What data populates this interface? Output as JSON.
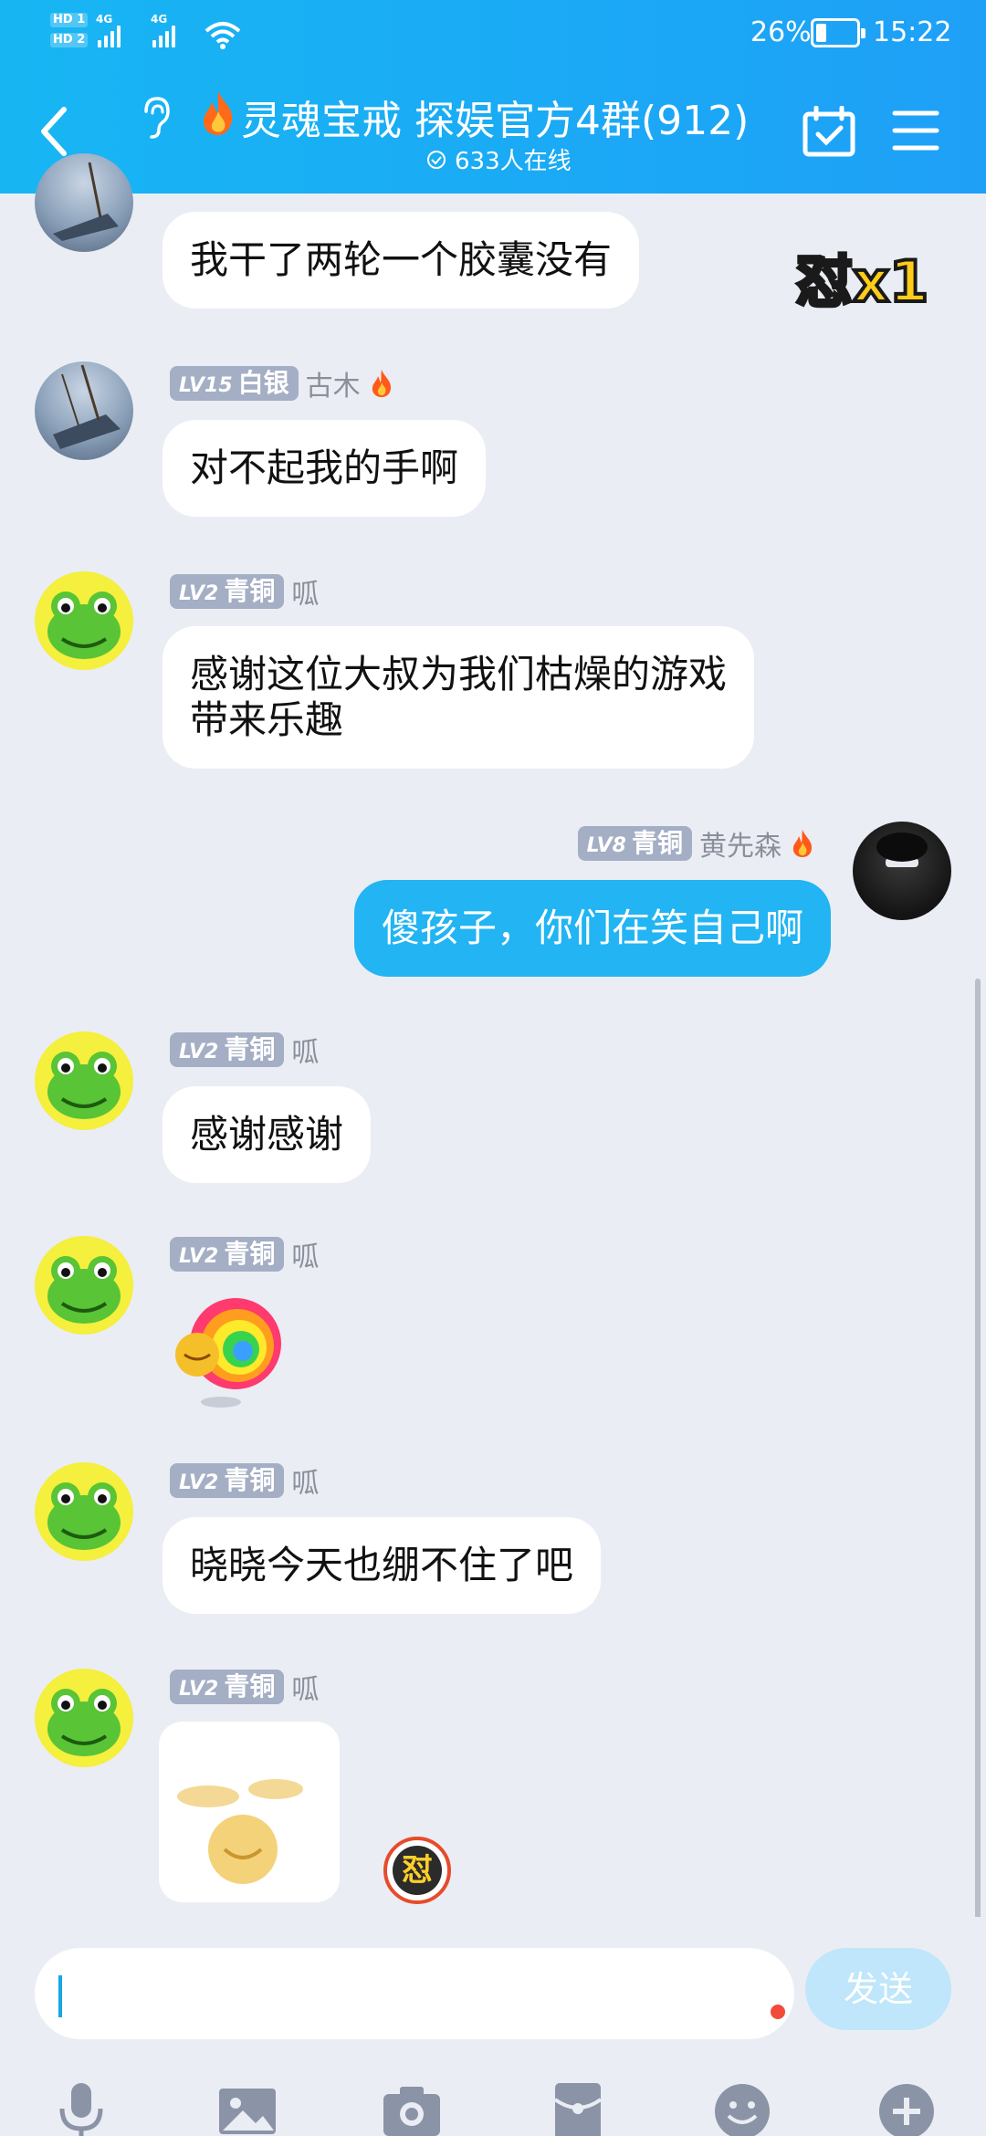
{
  "status_bar": {
    "hd1": "HD 1",
    "hd2": "HD 2",
    "net1": "4G",
    "net2": "4G",
    "battery": "26%",
    "battery_level": 0.26,
    "time": "15:22"
  },
  "header": {
    "title": "灵魂宝戒 探娱官方4群(912)",
    "online": "633人在线"
  },
  "sticker_badge": "怼",
  "sticker_banner": "怼x1",
  "messages": [
    {
      "text": "我干了两轮一个胶囊没有"
    },
    {
      "level": "LV15",
      "rank": "白银",
      "nick": "古木",
      "text": "对不起我的手啊"
    },
    {
      "level": "LV2",
      "rank": "青铜",
      "nick": "呱",
      "text_line1": "感谢这位大叔为我们枯燥的游戏",
      "text_line2": "带来乐趣"
    },
    {
      "level": "LV8",
      "rank": "青铜",
      "nick": "黄先森",
      "text": "傻孩子，你们在笑自己啊"
    },
    {
      "level": "LV2",
      "rank": "青铜",
      "nick": "呱",
      "text": "感谢感谢"
    },
    {
      "level": "LV2",
      "rank": "青铜",
      "nick": "呱",
      "sticker": "rainbow-afro-emoji"
    },
    {
      "level": "LV2",
      "rank": "青铜",
      "nick": "呱",
      "text": "晓晓今天也绷不住了吧"
    },
    {
      "level": "LV2",
      "rank": "青铜",
      "nick": "呱",
      "sticker": "laughing-emoji-image"
    }
  ],
  "input": {
    "placeholder": "",
    "send": "发送"
  },
  "toolbar_icons": [
    "microphone-icon",
    "image-icon",
    "camera-icon",
    "red-packet-icon",
    "emoji-icon",
    "plus-icon"
  ],
  "colors": {
    "header": "#1ea0f7",
    "self_bubble": "#22b4f3",
    "background": "#eaedf4",
    "badge": "#a4aec4"
  }
}
